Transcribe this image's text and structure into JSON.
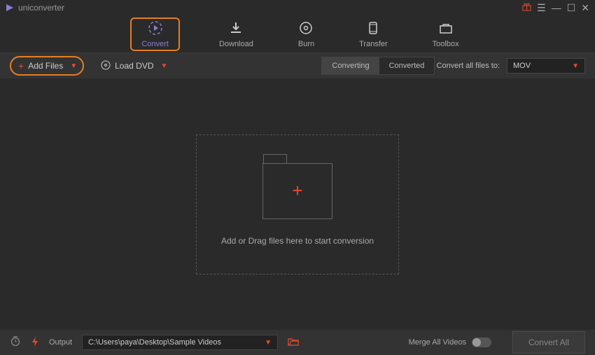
{
  "app": {
    "title": "uniconverter"
  },
  "nav": {
    "tabs": [
      {
        "label": "Convert"
      },
      {
        "label": "Download"
      },
      {
        "label": "Burn"
      },
      {
        "label": "Transfer"
      },
      {
        "label": "Toolbox"
      }
    ]
  },
  "toolbar": {
    "add_files": "Add Files",
    "load_dvd": "Load DVD",
    "segments": [
      {
        "label": "Converting"
      },
      {
        "label": "Converted"
      }
    ],
    "convert_all_label": "Convert all files to:",
    "format": "MOV"
  },
  "main": {
    "drop_text": "Add or Drag files here to start conversion"
  },
  "bottom": {
    "output_label": "Output",
    "output_path": "C:\\Users\\paya\\Desktop\\Sample Videos",
    "merge_label": "Merge All Videos",
    "convert_all_btn": "Convert All"
  },
  "colors": {
    "accent_orange": "#e67e22",
    "accent_red": "#e64a2e",
    "accent_purple": "#8a7fd4"
  }
}
